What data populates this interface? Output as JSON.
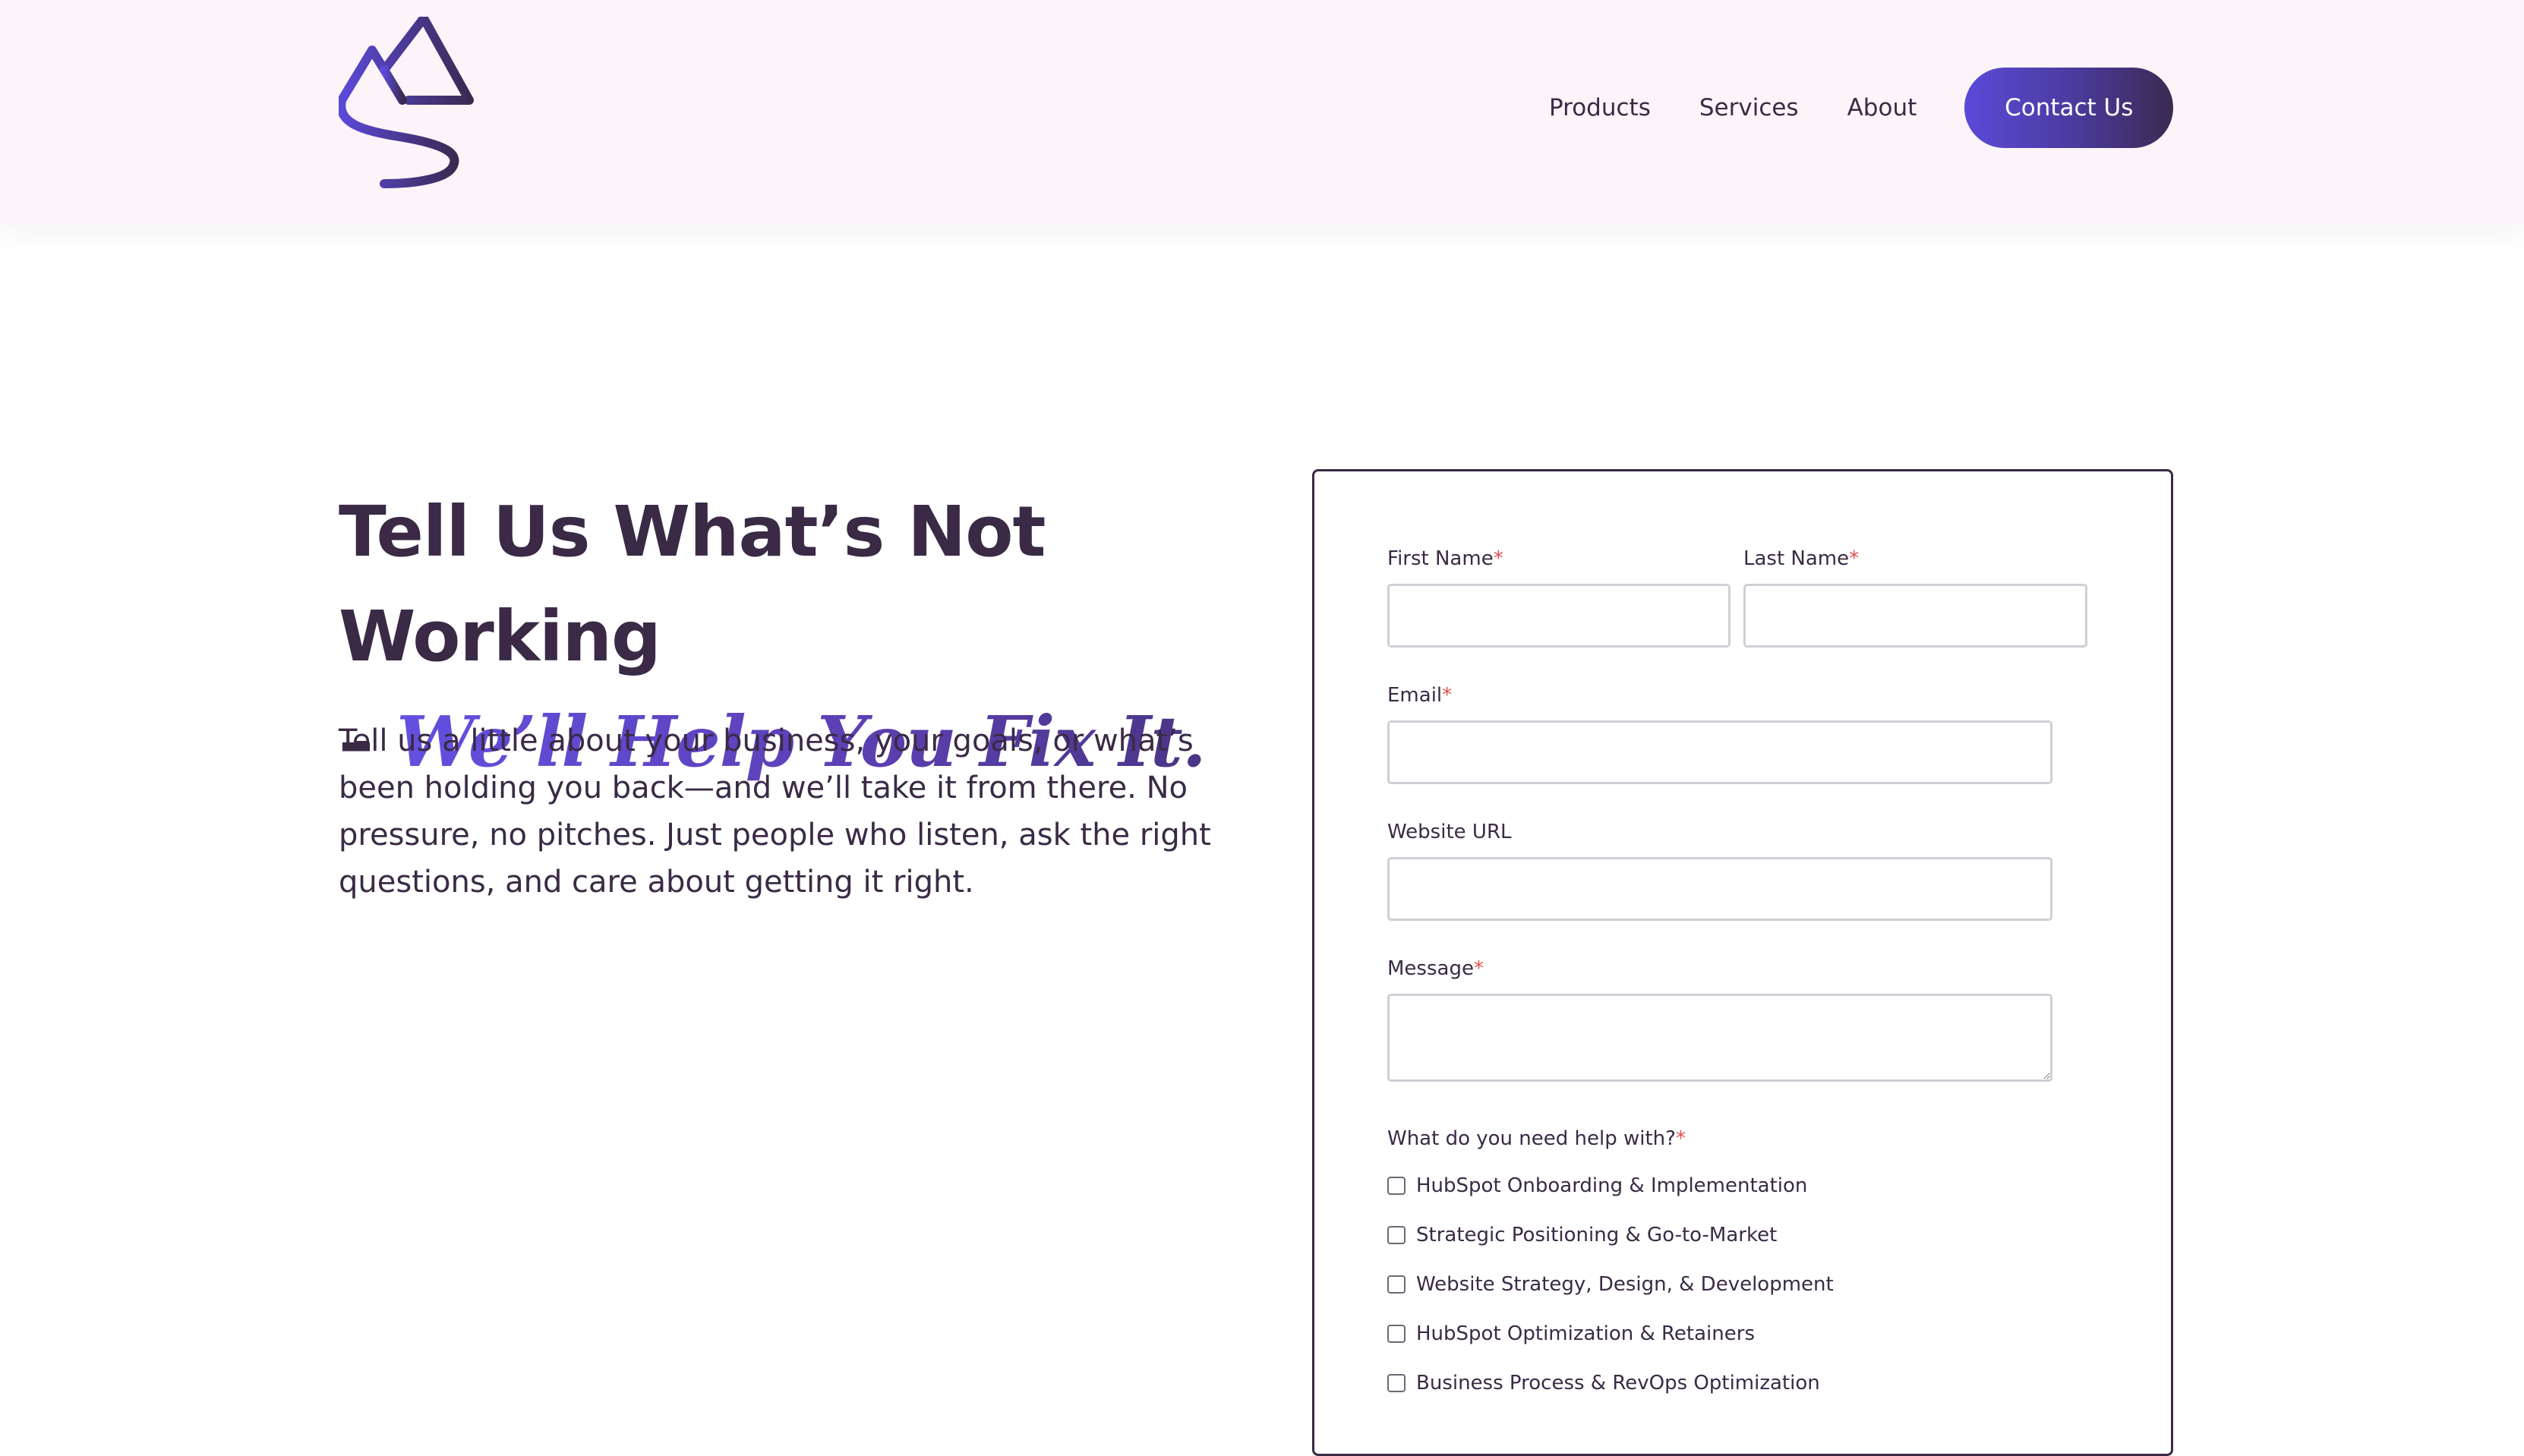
{
  "header": {
    "logo_icon": "mountain-s-logo-icon",
    "nav": [
      {
        "label": "Products"
      },
      {
        "label": "Services"
      },
      {
        "label": "About"
      }
    ],
    "contact_label": "Contact Us"
  },
  "hero": {
    "title_line1": "Tell Us What’s Not Working",
    "title_dash": "–",
    "title_accent": "We’ll Help You Fix It.",
    "body": "Tell us a little about your business, your goals, or what’s been holding you back—and we’ll take it from there. No pressure, no pitches. Just people who listen, ask the right questions, and care about getting it right."
  },
  "form": {
    "required_mark": "*",
    "first_name_label": "First Name",
    "last_name_label": "Last Name",
    "email_label": "Email",
    "website_label": "Website URL",
    "message_label": "Message",
    "help_label": "What do you need help with?",
    "options": [
      {
        "label": "HubSpot Onboarding & Implementation"
      },
      {
        "label": "Strategic Positioning & Go-to-Market"
      },
      {
        "label": "Website Strategy, Design, & Development"
      },
      {
        "label": "HubSpot Optimization & Retainers"
      },
      {
        "label": "Business Process & RevOps Optimization"
      }
    ]
  },
  "colors": {
    "accent": "#5b4ad9",
    "dark": "#3b2a45",
    "header_bg": "#fcf4f9",
    "required": "#e05050"
  }
}
